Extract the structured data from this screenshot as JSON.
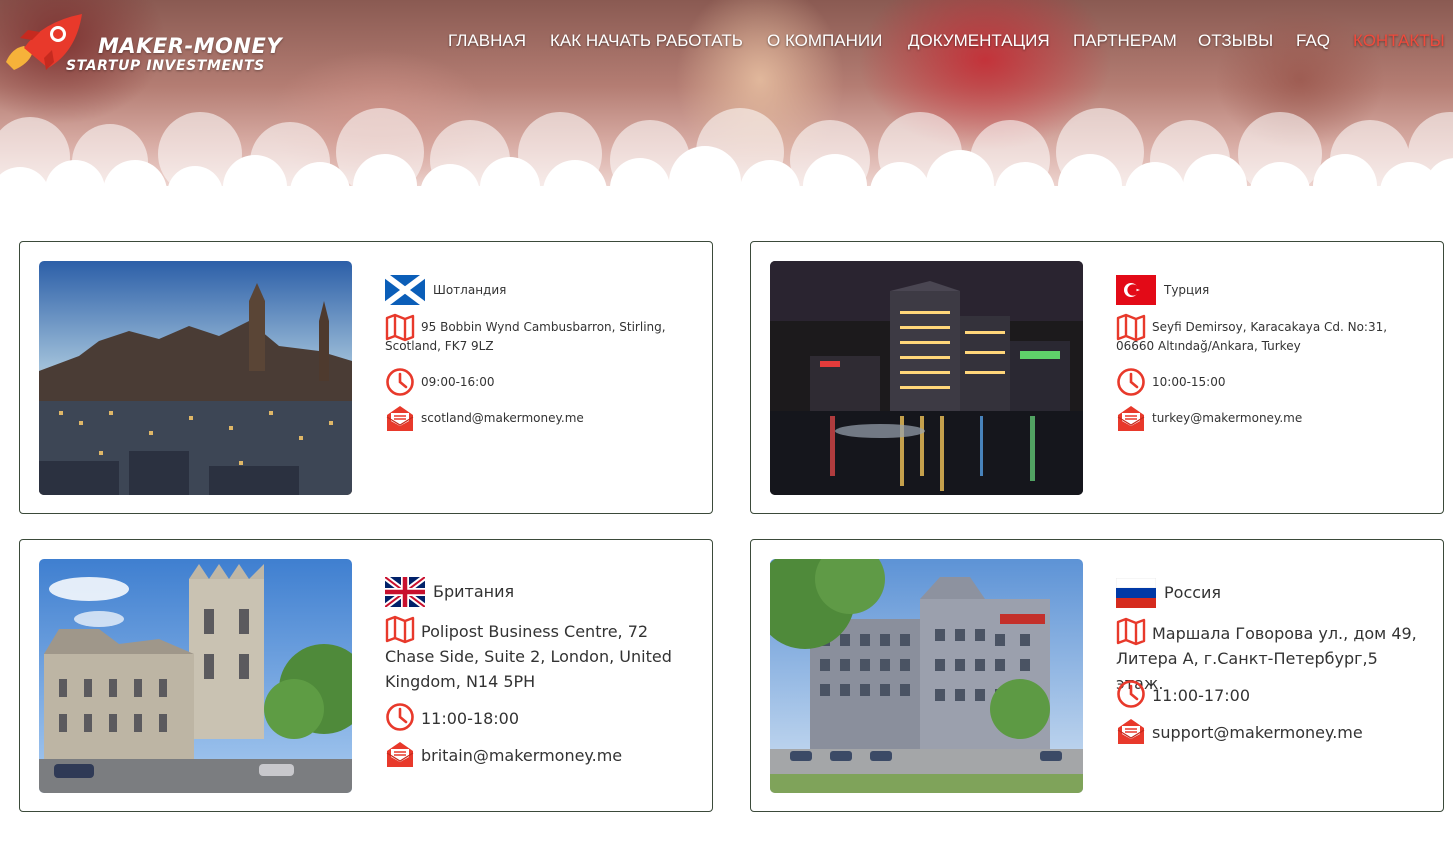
{
  "logo": {
    "title": "MAKER-MONEY",
    "subtitle": "STARTUP INVESTMENTS"
  },
  "nav": {
    "items": [
      {
        "label": "ГЛАВНАЯ"
      },
      {
        "label": "КАК НАЧАТЬ РАБОТАТЬ"
      },
      {
        "label": "О КОМПАНИИ"
      },
      {
        "label": "ДОКУМЕНТАЦИЯ"
      },
      {
        "label": "ПАРТНЕРАМ"
      },
      {
        "label": "ОТЗЫВЫ"
      },
      {
        "label": "FAQ"
      },
      {
        "label": "КОНТАКТЫ",
        "active": true
      }
    ]
  },
  "offices": [
    {
      "country": "Шотландия",
      "flag": "scotland-flag",
      "address": "95 Bobbin Wynd Cambusbarron, Stirling, Scotland, FK7 9LZ",
      "hours": "09:00-16:00",
      "email": "scotland@makermoney.me",
      "photo": "edinburgh-city-photo"
    },
    {
      "country": "Турция",
      "flag": "turkey-flag",
      "address": "Seyfi Demirsoy, Karacakaya Cd. No:31, 06660 Altındağ/Ankara, Turkey",
      "hours": "10:00-15:00",
      "email": "turkey@makermoney.me",
      "photo": "ankara-night-photo"
    },
    {
      "country": "Британия",
      "flag": "uk-flag",
      "address": "Polipost Business Centre, 72 Chase Side, Suite 2, London, United Kingdom, N14 5PH",
      "hours": "11:00-18:00",
      "email": "britain@makermoney.me",
      "photo": "london-building-photo"
    },
    {
      "country": "Россия",
      "flag": "russia-flag",
      "address": "Маршала Говорова ул., дом 49, Литера А, г.Санкт-Петербург,5 этаж.",
      "hours": "11:00-17:00",
      "email": "support@makermoney.me",
      "photo": "st-petersburg-office-photo"
    }
  ],
  "colors": {
    "accent": "#ee4a3c",
    "card_border": "#3b4a3a",
    "nav_text": "#ffffff"
  },
  "icons": [
    "rocket-icon",
    "map-icon",
    "clock-icon",
    "envelope-icon"
  ]
}
